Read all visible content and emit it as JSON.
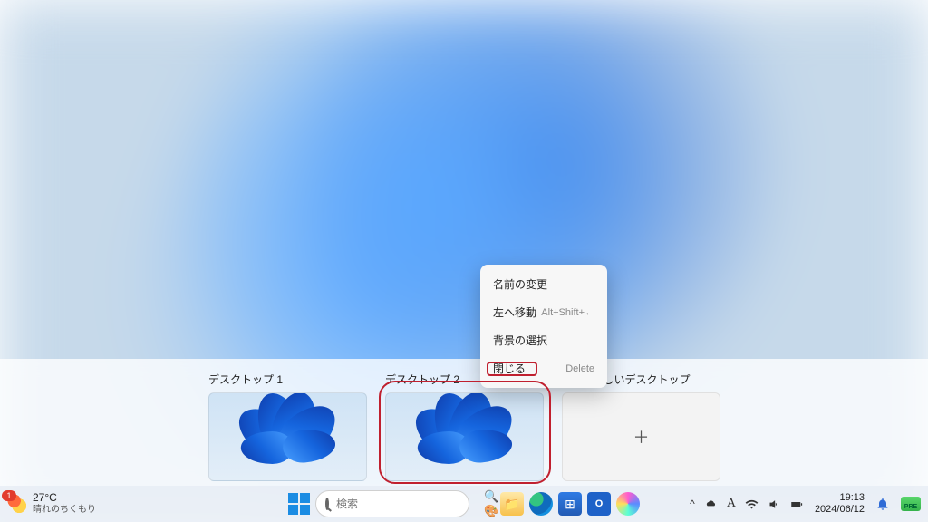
{
  "taskview": {
    "desktops": [
      {
        "label": "デスクトップ 1"
      },
      {
        "label": "デスクトップ 2"
      }
    ],
    "new_desktop_label": "新しいデスクトップ"
  },
  "context_menu": {
    "rename": "名前の変更",
    "move_left": "左へ移動",
    "move_left_shortcut": "Alt+Shift+←",
    "choose_background": "背景の選択",
    "close": "閉じる",
    "close_shortcut": "Delete"
  },
  "taskbar": {
    "weather": {
      "badge": "1",
      "temp": "27°C",
      "desc": "晴れのちくもり"
    },
    "search_placeholder": "検索",
    "ime": "A",
    "time": "19:13",
    "date": "2024/06/12",
    "pre_badge": "PRE",
    "chevron": "^"
  }
}
